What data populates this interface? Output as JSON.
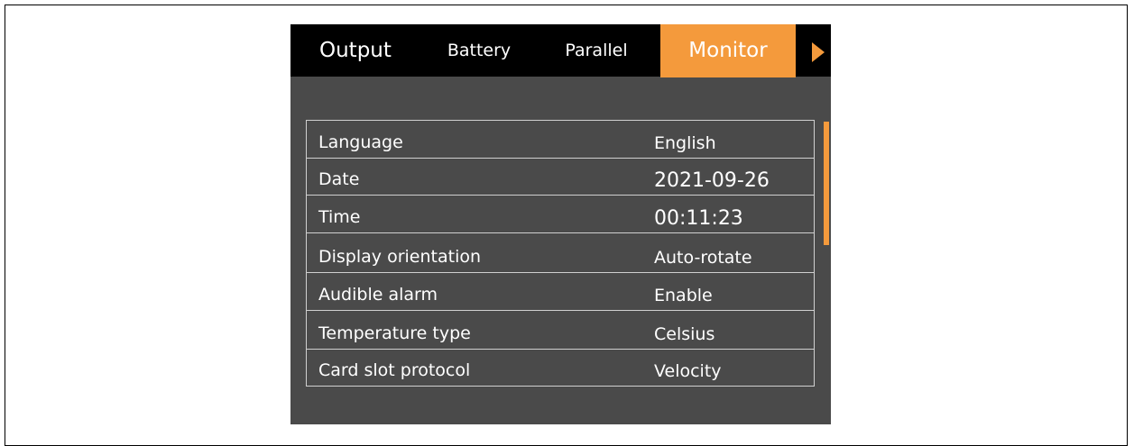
{
  "tabs": [
    {
      "label": "Output",
      "active": false
    },
    {
      "label": "Battery",
      "active": false
    },
    {
      "label": "Parallel",
      "active": false
    },
    {
      "label": "Monitor",
      "active": true
    }
  ],
  "settings": [
    {
      "label": "Language",
      "value": "English"
    },
    {
      "label": "Date",
      "value": "2021-09-26"
    },
    {
      "label": "Time",
      "value": "00:11:23"
    },
    {
      "label": "Display orientation",
      "value": "Auto-rotate"
    },
    {
      "label": "Audible alarm",
      "value": "Enable"
    },
    {
      "label": "Temperature type",
      "value": "Celsius"
    },
    {
      "label": "Card slot protocol",
      "value": "Velocity"
    }
  ],
  "icons": {
    "next_tab": "right-arrow-icon"
  },
  "colors": {
    "accent": "#f49a3c",
    "tabbar_background": "#000000",
    "panel_background": "#4a4a4a",
    "text": "#ffffff",
    "row_border": "#d0d0d0"
  }
}
